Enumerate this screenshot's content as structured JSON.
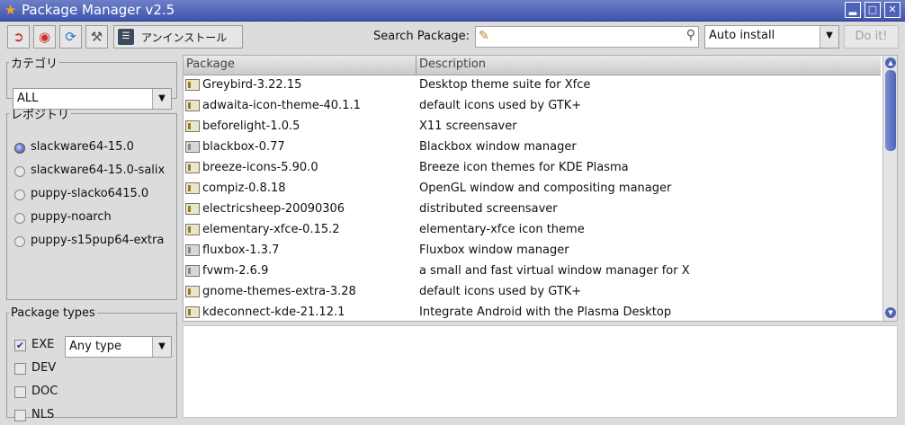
{
  "window": {
    "title": "Package Manager v2.5"
  },
  "toolbar": {
    "install_label": "アンインストール",
    "search_label": "Search Package:",
    "search_value": "",
    "mode": "Auto install",
    "doit_label": "Do it!"
  },
  "category": {
    "legend": "カテゴリ",
    "selected": "ALL"
  },
  "repos": {
    "legend": "レポジトリ",
    "items": [
      "slackware64-15.0",
      "slackware64-15.0-salix",
      "puppy-slacko6415.0",
      "puppy-noarch",
      "puppy-s15pup64-extra"
    ],
    "selected_index": 0
  },
  "pkgtypes": {
    "legend": "Package types",
    "items": [
      {
        "label": "EXE",
        "checked": true
      },
      {
        "label": "DEV",
        "checked": false
      },
      {
        "label": "DOC",
        "checked": false
      },
      {
        "label": "NLS",
        "checked": false
      }
    ],
    "type_selected": "Any type"
  },
  "table": {
    "headers": {
      "package": "Package",
      "description": "Description"
    },
    "rows": [
      {
        "name": "Greybird-3.22.15",
        "desc": "Desktop theme suite for Xfce",
        "icon": "package-icon"
      },
      {
        "name": "adwaita-icon-theme-40.1.1",
        "desc": "default icons used by GTK+",
        "icon": "package-icon"
      },
      {
        "name": "beforelight-1.0.5",
        "desc": "X11 screensaver",
        "icon": "package-icon"
      },
      {
        "name": "blackbox-0.77",
        "desc": "Blackbox window manager",
        "icon": "window-manager-icon"
      },
      {
        "name": "breeze-icons-5.90.0",
        "desc": "Breeze icon themes for KDE Plasma",
        "icon": "package-icon"
      },
      {
        "name": "compiz-0.8.18",
        "desc": "OpenGL window and compositing manager",
        "icon": "package-icon"
      },
      {
        "name": "electricsheep-20090306",
        "desc": "distributed screensaver",
        "icon": "package-icon"
      },
      {
        "name": "elementary-xfce-0.15.2",
        "desc": "elementary-xfce icon theme",
        "icon": "package-icon"
      },
      {
        "name": "fluxbox-1.3.7",
        "desc": "Fluxbox window manager",
        "icon": "window-manager-icon"
      },
      {
        "name": "fvwm-2.6.9",
        "desc": "a small and fast virtual window manager for X",
        "icon": "window-manager-icon"
      },
      {
        "name": "gnome-themes-extra-3.28",
        "desc": "default icons used by GTK+",
        "icon": "package-icon"
      },
      {
        "name": "kdeconnect-kde-21.12.1",
        "desc": "Integrate Android with the Plasma Desktop",
        "icon": "package-icon"
      }
    ]
  },
  "icons": {
    "title": "star-icon",
    "toolbar": [
      "exit-icon",
      "help-lifebuoy-icon",
      "refresh-icon",
      "tools-icon"
    ],
    "install": "install-icon",
    "search_clear": "broom-icon",
    "search": "magnifier-icon"
  }
}
